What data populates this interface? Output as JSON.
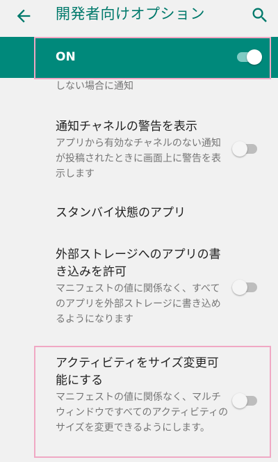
{
  "appbar": {
    "title": "開発者向けオプション",
    "back_icon": "arrow-left-icon",
    "search_icon": "search-icon"
  },
  "master": {
    "label": "ON",
    "checked": true
  },
  "colors": {
    "accent": "#00796b",
    "master_bar": "#00897b",
    "highlight": "#f0a8c4",
    "background": "#f1f1f1"
  },
  "prefs": {
    "partial_summary": "しない場合に通知",
    "notif_warning": {
      "title": "通知チャネルの警告を表示",
      "summary": "アプリから有効なチャネルのない通知が投稿されたときに画面上に警告を表示します",
      "checked": false
    },
    "standby": {
      "title": "スタンバイ状態のアプリ"
    },
    "external_storage": {
      "title": "外部ストレージへのアプリの書き込みを許可",
      "summary": "マニフェストの値に関係なく、すべてのアプリを外部ストレージに書き込めるようになります",
      "checked": false
    },
    "resizable": {
      "title": "アクティビティをサイズ変更可能にする",
      "summary": "マニフェストの値に関係なく、マルチウィンドウですべてのアクティビティのサイズを変更できるようにします。",
      "checked": false
    }
  }
}
